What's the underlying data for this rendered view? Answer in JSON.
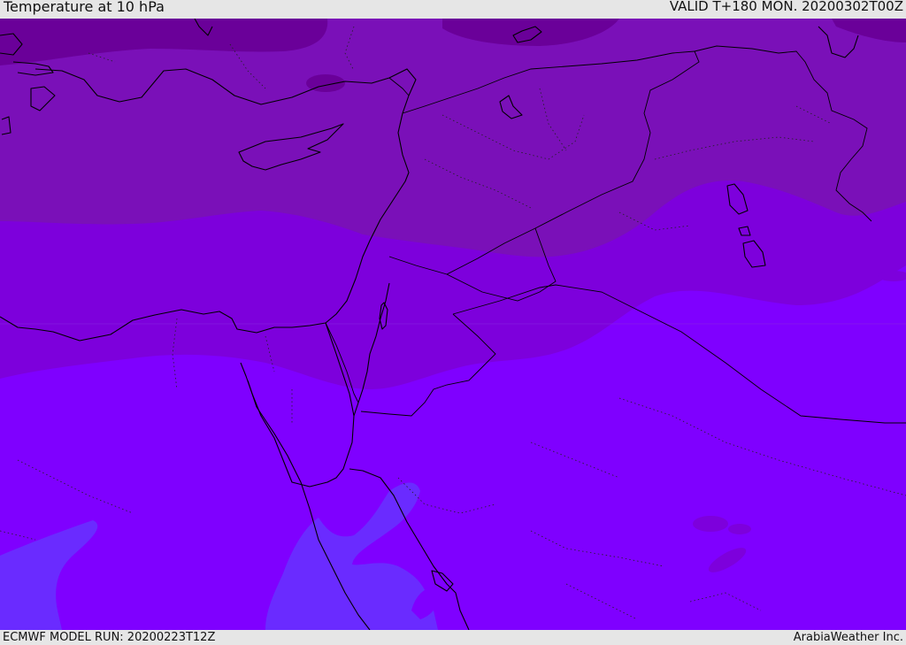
{
  "header": {
    "title": "Temperature at 10 hPa",
    "valid": "VALID T+180 MON. 20200302T00Z"
  },
  "footer": {
    "model_run": "ECMWF MODEL RUN: 20200223T12Z",
    "credit": "ArabiaWeather Inc."
  },
  "map": {
    "colors": {
      "band_darkest": "#6a0099",
      "band_dark": "#7a10b8",
      "band_mid": "#7d00dc",
      "band_main": "#7f00ff",
      "band_blue": "#6a2bff",
      "coastline": "#000000"
    },
    "features": [
      "cyprus-island",
      "sinai-peninsula",
      "red-sea",
      "persian-gulf",
      "dead-sea",
      "lake-tuz"
    ]
  }
}
